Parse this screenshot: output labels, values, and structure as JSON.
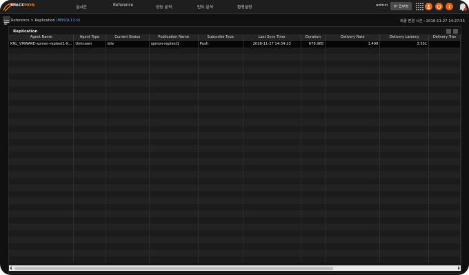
{
  "nav": {
    "logo_prefix": "SPACE",
    "logo_suffix": "MON",
    "items": [
      "실시간",
      "Reference",
      "성능 분석",
      "빈도 분석",
      "환경설정"
    ],
    "user": "admin",
    "work_button": "업무명",
    "icons": [
      "grid-icon",
      "person-icon",
      "power-icon",
      "info-icon",
      "bell-icon"
    ],
    "accent_color": "#e8641c"
  },
  "breadcrumb": {
    "root": "Reference",
    "separator": ">",
    "page": "Replication",
    "tag": "(MSSQL11-0)"
  },
  "last_change": {
    "label": "최종 변경 시간 :",
    "value": "2018-11-27 14:27:55"
  },
  "panel": {
    "title": "Replication",
    "columns": [
      "Agent Name",
      "Agent Type",
      "Current Status",
      "Publication Name",
      "Subscribe Type",
      "Last Sync Time",
      "Duration",
      "Delivery Rate",
      "Delivery Latency",
      "Delivery Tran"
    ],
    "rows": [
      [
        "KNL_VMWARE-spmon-reptest1-K...",
        "Unknown",
        "idle",
        "spmon-reptest1",
        "Push",
        "2018-11-27 14:34:23",
        "679.985",
        "1.499",
        "3.551",
        ""
      ]
    ]
  }
}
